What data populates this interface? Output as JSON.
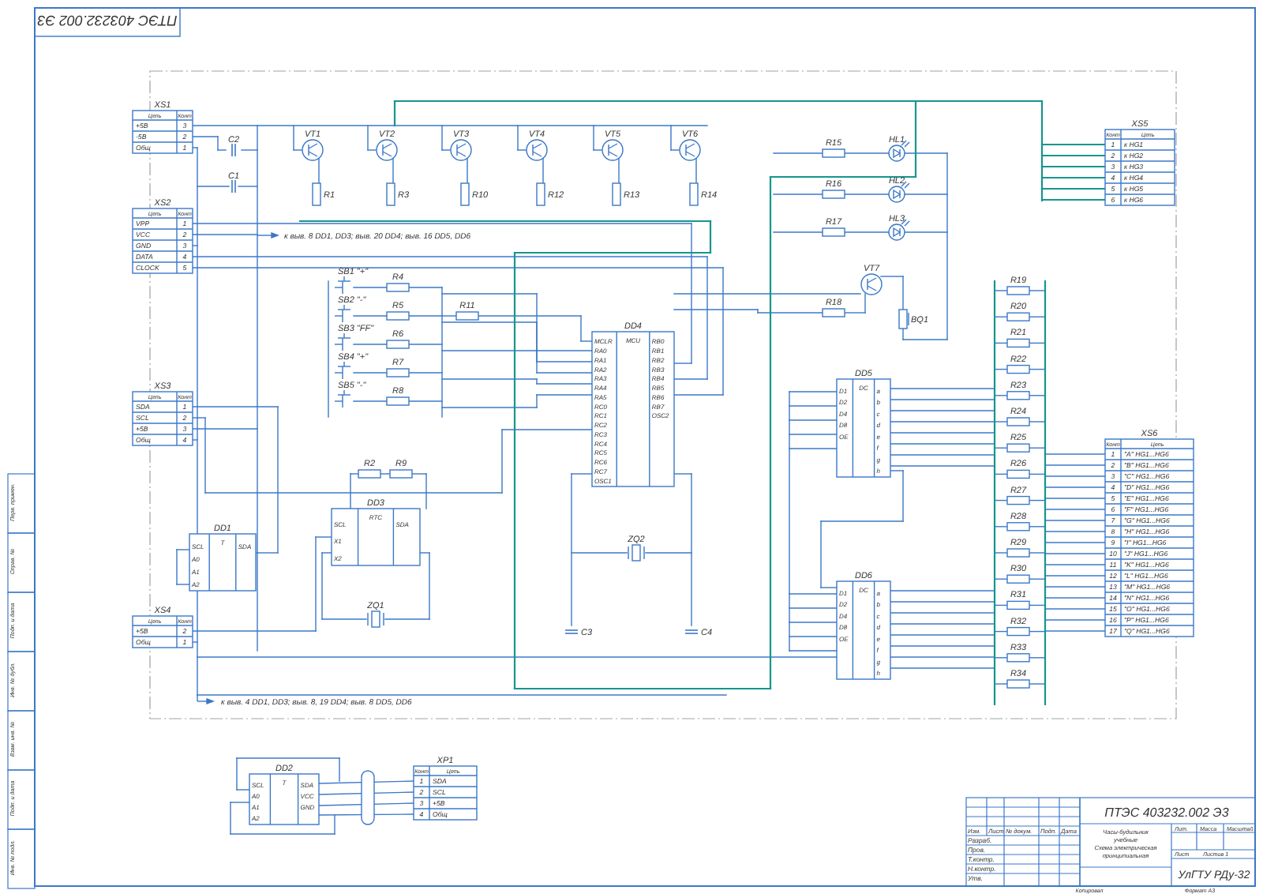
{
  "stamp": {
    "code": "ПТЭС 403232.002 Э3"
  },
  "side_labels": [
    "Перв. примен.",
    "Справ. №",
    "Подп. и дата",
    "Инв. № дубл.",
    "Взам. инв. №",
    "Подп. и дата",
    "Инв. № подл."
  ],
  "connectors": [
    {
      "label": "XS1",
      "header": [
        "Цепь",
        "Конт"
      ],
      "rows": [
        {
          "name": "+5В",
          "num": "3"
        },
        {
          "name": "-5В",
          "num": "2"
        },
        {
          "name": "Общ",
          "num": "1"
        }
      ]
    },
    {
      "label": "XS2",
      "header": [
        "Цепь",
        "Конт"
      ],
      "rows": [
        {
          "name": "VPP",
          "num": "1"
        },
        {
          "name": "VCC",
          "num": "2"
        },
        {
          "name": "GND",
          "num": "3"
        },
        {
          "name": "DATA",
          "num": "4"
        },
        {
          "name": "CLOCK",
          "num": "5"
        }
      ]
    },
    {
      "label": "XS3",
      "header": [
        "Цепь",
        "Конт"
      ],
      "rows": [
        {
          "name": "SDA",
          "num": "1"
        },
        {
          "name": "SCL",
          "num": "2"
        },
        {
          "name": "+5В",
          "num": "3"
        },
        {
          "name": "Общ",
          "num": "4"
        }
      ]
    },
    {
      "label": "XS4",
      "header": [
        "Цепь",
        "Конт"
      ],
      "rows": [
        {
          "name": "+5В",
          "num": "2"
        },
        {
          "name": "Общ",
          "num": "1"
        }
      ]
    },
    {
      "label": "XS5",
      "header": [
        "Конт",
        "Цепь"
      ],
      "rows": [
        {
          "name": "к HG1",
          "num": "1"
        },
        {
          "name": "к HG2",
          "num": "2"
        },
        {
          "name": "к HG3",
          "num": "3"
        },
        {
          "name": "к HG4",
          "num": "4"
        },
        {
          "name": "к HG5",
          "num": "5"
        },
        {
          "name": "к HG6",
          "num": "6"
        }
      ]
    },
    {
      "label": "XS6",
      "header": [
        "Конт",
        "Цепь"
      ],
      "rows": [
        {
          "name": "\"A\" HG1...HG6",
          "num": "1"
        },
        {
          "name": "\"B\" HG1...HG6",
          "num": "2"
        },
        {
          "name": "\"C\" HG1...HG6",
          "num": "3"
        },
        {
          "name": "\"D\" HG1...HG6",
          "num": "4"
        },
        {
          "name": "\"E\" HG1...HG6",
          "num": "5"
        },
        {
          "name": "\"F\" HG1...HG6",
          "num": "6"
        },
        {
          "name": "\"G\" HG1...HG6",
          "num": "7"
        },
        {
          "name": "\"H\" HG1...HG6",
          "num": "8"
        },
        {
          "name": "\"I\" HG1...HG6",
          "num": "9"
        },
        {
          "name": "\"J\" HG1...HG6",
          "num": "10"
        },
        {
          "name": "\"K\" HG1...HG6",
          "num": "11"
        },
        {
          "name": "\"L\" HG1...HG6",
          "num": "12"
        },
        {
          "name": "\"M\" HG1...HG6",
          "num": "13"
        },
        {
          "name": "\"N\" HG1...HG6",
          "num": "14"
        },
        {
          "name": "\"O\" HG1...HG6",
          "num": "15"
        },
        {
          "name": "\"P\" HG1...HG6",
          "num": "16"
        },
        {
          "name": "\"Q\" HG1...HG6",
          "num": "17"
        }
      ]
    },
    {
      "label": "XP1",
      "header": [
        "Конт",
        "Цепь"
      ],
      "rows": [
        {
          "name": "SDA",
          "num": "1"
        },
        {
          "name": "SCL",
          "num": "2"
        },
        {
          "name": "+5В",
          "num": "3"
        },
        {
          "name": "Общ",
          "num": "4"
        }
      ]
    }
  ],
  "components": [
    {
      "kind": "capacitor",
      "label": "C2"
    },
    {
      "kind": "capacitor",
      "label": "C1"
    },
    {
      "kind": "transistor",
      "label": "VT1"
    },
    {
      "kind": "transistor",
      "label": "VT2"
    },
    {
      "kind": "transistor",
      "label": "VT3"
    },
    {
      "kind": "transistor",
      "label": "VT4"
    },
    {
      "kind": "transistor",
      "label": "VT5"
    },
    {
      "kind": "transistor",
      "label": "VT6"
    },
    {
      "kind": "resistor",
      "label": "R1"
    },
    {
      "kind": "resistor",
      "label": "R3"
    },
    {
      "kind": "resistor",
      "label": "R10"
    },
    {
      "kind": "resistor",
      "label": "R12"
    },
    {
      "kind": "resistor",
      "label": "R13"
    },
    {
      "kind": "resistor",
      "label": "R14"
    },
    {
      "kind": "resistor",
      "label": "R15"
    },
    {
      "kind": "resistor",
      "label": "R16"
    },
    {
      "kind": "resistor",
      "label": "R17"
    },
    {
      "kind": "led",
      "label": "HL1"
    },
    {
      "kind": "led",
      "label": "HL2"
    },
    {
      "kind": "led",
      "label": "HL3"
    },
    {
      "kind": "transistor",
      "label": "VT7"
    },
    {
      "kind": "resistor",
      "label": "R18"
    },
    {
      "kind": "speaker",
      "label": "BQ1"
    },
    {
      "kind": "switch",
      "label": "SB1 \"+\""
    },
    {
      "kind": "switch",
      "label": "SB2 \"-\""
    },
    {
      "kind": "switch",
      "label": "SB3 \"FF\""
    },
    {
      "kind": "switch",
      "label": "SB4 \"+\""
    },
    {
      "kind": "switch",
      "label": "SB5 \"-\""
    },
    {
      "kind": "resistor",
      "label": "R4"
    },
    {
      "kind": "resistor",
      "label": "R5"
    },
    {
      "kind": "resistor",
      "label": "R6"
    },
    {
      "kind": "resistor",
      "label": "R7"
    },
    {
      "kind": "resistor",
      "label": "R8"
    },
    {
      "kind": "resistor",
      "label": "R11"
    },
    {
      "kind": "resistor",
      "label": "R2"
    },
    {
      "kind": "resistor",
      "label": "R9"
    },
    {
      "kind": "quartz",
      "label": "ZQ1"
    },
    {
      "kind": "quartz",
      "label": "ZQ2"
    },
    {
      "kind": "capacitor",
      "label": "C3"
    },
    {
      "kind": "capacitor",
      "label": "C4"
    },
    {
      "kind": "chip",
      "label": "DD1",
      "left": [
        "SCL",
        "A0",
        "A1",
        "A2"
      ],
      "center": "T",
      "right": [
        "SDA"
      ]
    },
    {
      "kind": "chip",
      "label": "DD3",
      "left": [
        "SCL",
        "X1",
        "X2"
      ],
      "center": "RTC",
      "right": [
        "SDA"
      ]
    },
    {
      "kind": "chip",
      "label": "DD4",
      "left": [
        "MCLR",
        "RA0",
        "RA1",
        "RA2",
        "RA3",
        "RA4",
        "RA5",
        "RC0",
        "RC1",
        "RC2",
        "RC3",
        "RC4",
        "RC5",
        "RC6",
        "RC7",
        "OSC1"
      ],
      "center": "MCU",
      "right": [
        "RB0",
        "RB1",
        "RB2",
        "RB3",
        "RB4",
        "RB5",
        "RB6",
        "RB7",
        "OSC2"
      ]
    },
    {
      "kind": "chip",
      "label": "DD5",
      "left": [
        "D1",
        "D2",
        "D4",
        "D8",
        "OE"
      ],
      "center": "DC",
      "right": [
        "a",
        "b",
        "c",
        "d",
        "e",
        "f",
        "g",
        "h"
      ]
    },
    {
      "kind": "chip",
      "label": "DD6",
      "left": [
        "D1",
        "D2",
        "D4",
        "D8",
        "OE"
      ],
      "center": "DC",
      "right": [
        "a",
        "b",
        "c",
        "d",
        "e",
        "f",
        "g",
        "h"
      ]
    },
    {
      "kind": "chip",
      "label": "DD2",
      "left": [
        "SCL",
        "A0",
        "A1",
        "A2"
      ],
      "center": "T",
      "right": [
        "SDA",
        "VCC",
        "GND"
      ]
    },
    {
      "kind": "resistor",
      "label": "R19"
    },
    {
      "kind": "resistor",
      "label": "R20"
    },
    {
      "kind": "resistor",
      "label": "R21"
    },
    {
      "kind": "resistor",
      "label": "R22"
    },
    {
      "kind": "resistor",
      "label": "R23"
    },
    {
      "kind": "resistor",
      "label": "R24"
    },
    {
      "kind": "resistor",
      "label": "R25"
    },
    {
      "kind": "resistor",
      "label": "R26"
    },
    {
      "kind": "resistor",
      "label": "R27"
    },
    {
      "kind": "resistor",
      "label": "R28"
    },
    {
      "kind": "resistor",
      "label": "R29"
    },
    {
      "kind": "resistor",
      "label": "R30"
    },
    {
      "kind": "resistor",
      "label": "R31"
    },
    {
      "kind": "resistor",
      "label": "R32"
    },
    {
      "kind": "resistor",
      "label": "R33"
    },
    {
      "kind": "resistor",
      "label": "R34"
    }
  ],
  "notes": [
    "к выв. 8 DD1, DD3; выв. 20 DD4; выв. 16 DD5, DD6",
    "к выв. 4 DD1, DD3; выв. 8, 19 DD4; выв. 8 DD5, DD6"
  ],
  "title_block": {
    "code": "ПТЭС 403232.002 Э3",
    "title_lines": [
      "Часы-будильник",
      "учебные",
      "Схема электрическая",
      "принципиальная"
    ],
    "header": [
      "Изм.",
      "Лист",
      "№ докум.",
      "Подп.",
      "Дата"
    ],
    "roles": [
      "Разраб.",
      "Пров.",
      "Т.контр.",
      "Н.контр.",
      "Утв."
    ],
    "lit_header": [
      "Лит.",
      "Масса",
      "Масштаб"
    ],
    "sheet": "Лист",
    "sheets": "Листов 1",
    "org": "УлГТУ РДу-32",
    "footer_left": "Копировал",
    "footer_right": "Формат А3"
  }
}
